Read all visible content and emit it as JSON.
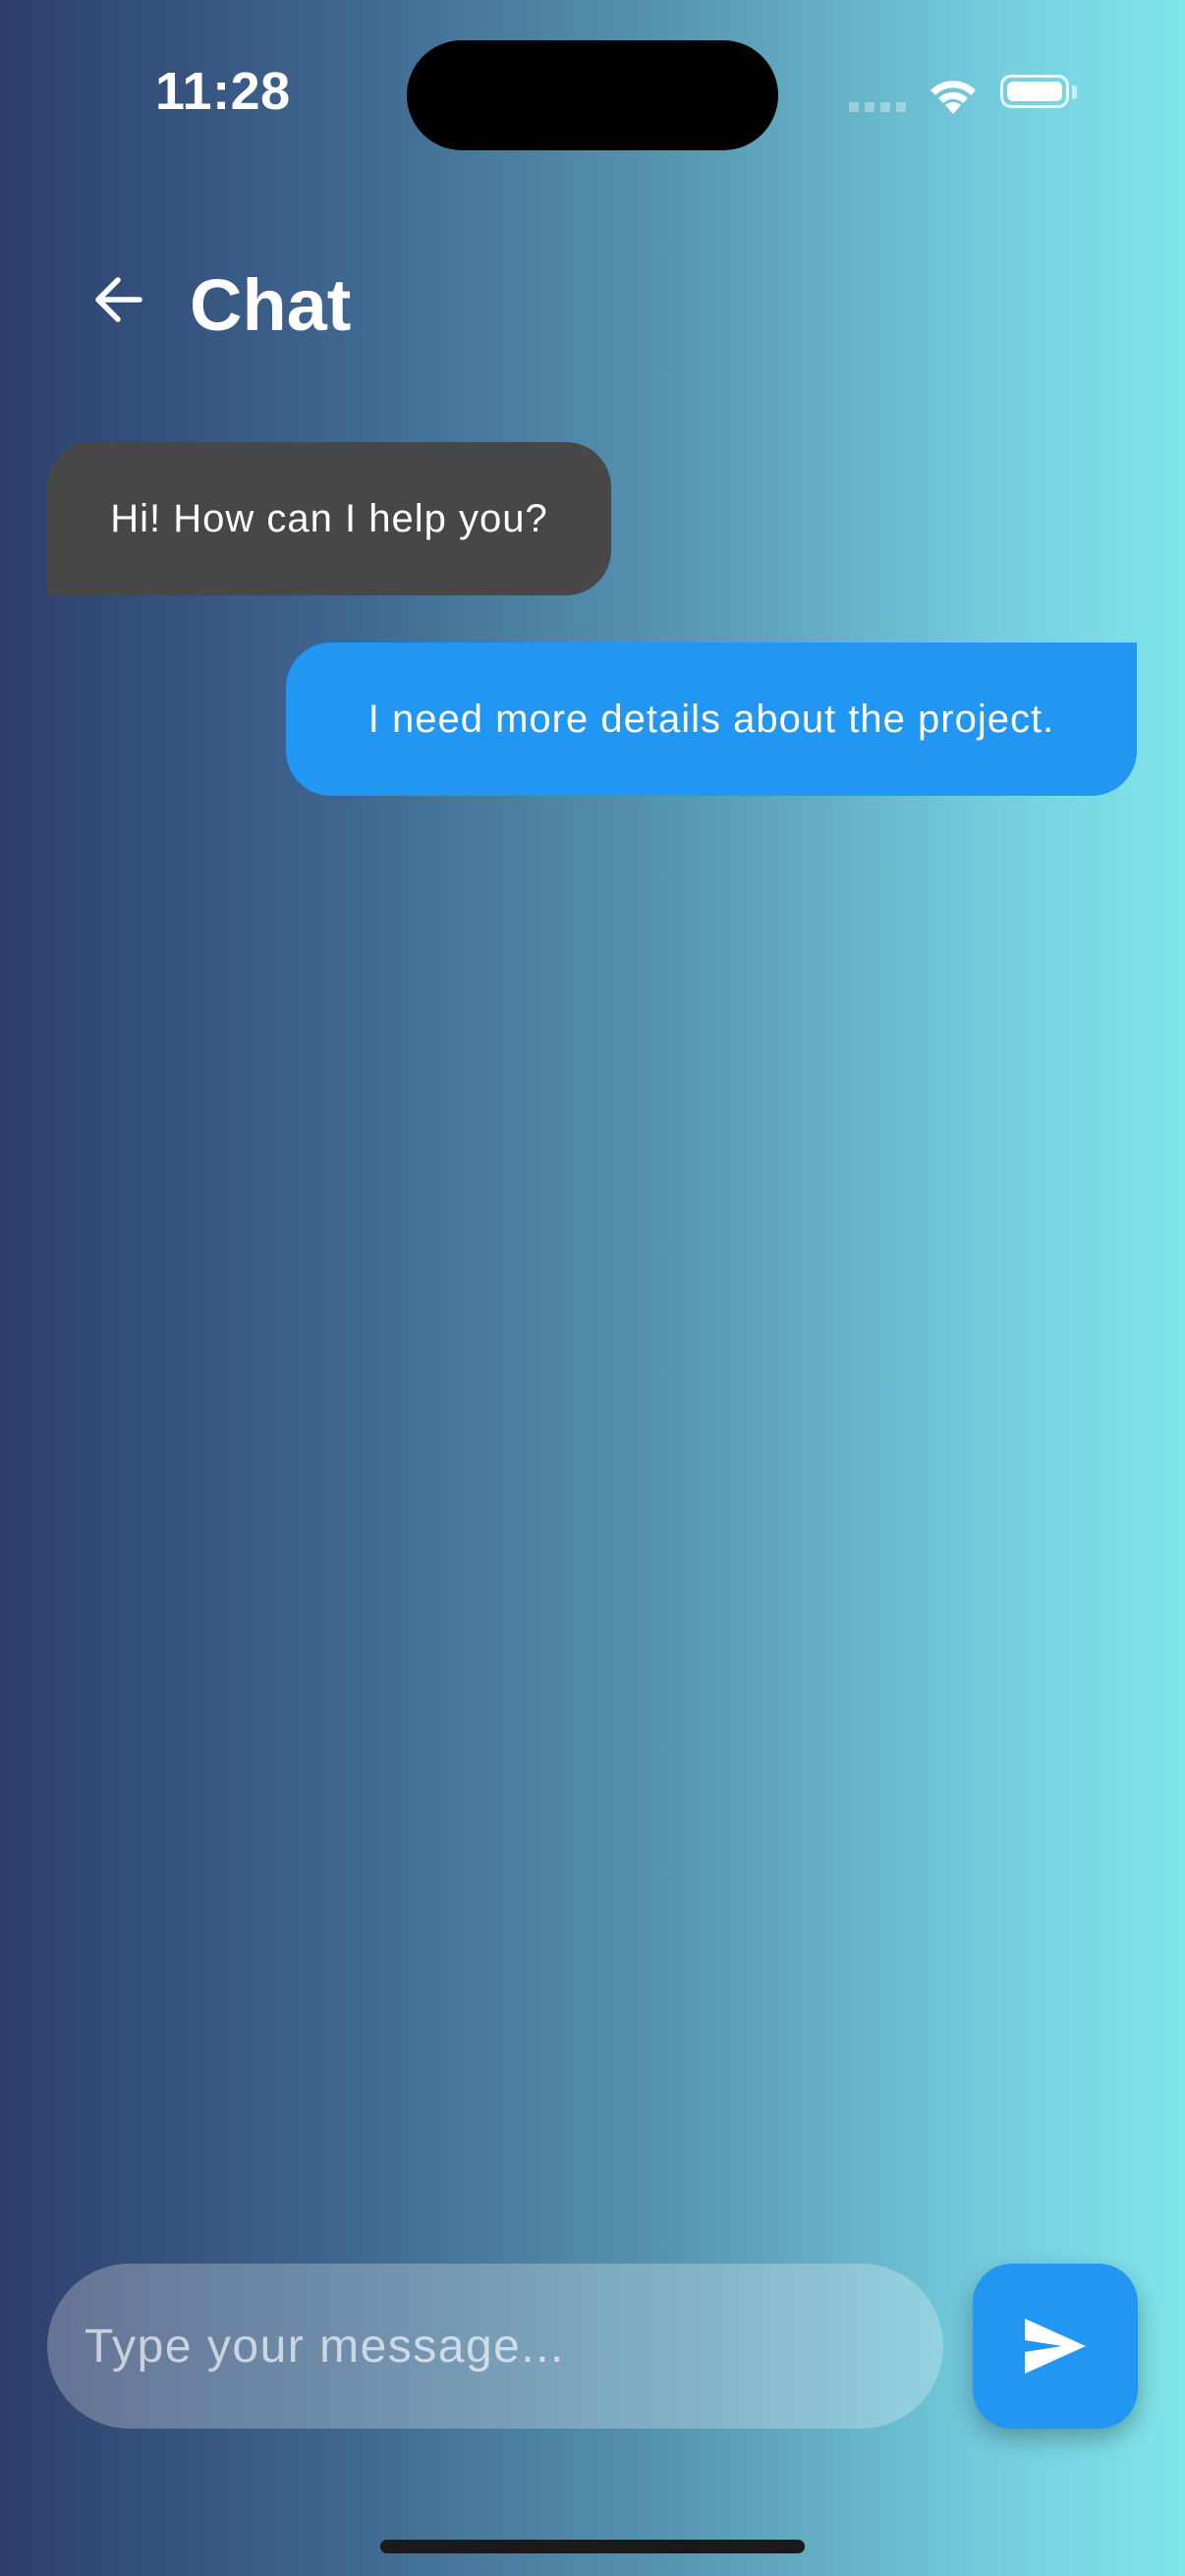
{
  "status_bar": {
    "time": "11:28",
    "icons": [
      "signal-icon",
      "wifi-icon",
      "battery-icon"
    ]
  },
  "app_bar": {
    "back_icon": "arrow-left-icon",
    "title": "Chat"
  },
  "messages": [
    {
      "sender": "bot",
      "text": "Hi! How can I help you?",
      "color": "#474747"
    },
    {
      "sender": "user",
      "text": "I need more details about the project.",
      "color": "#2196f3"
    }
  ],
  "composer": {
    "value": "",
    "placeholder": "Type your message...",
    "send_icon": "send-icon",
    "send_color": "#2196f3"
  }
}
